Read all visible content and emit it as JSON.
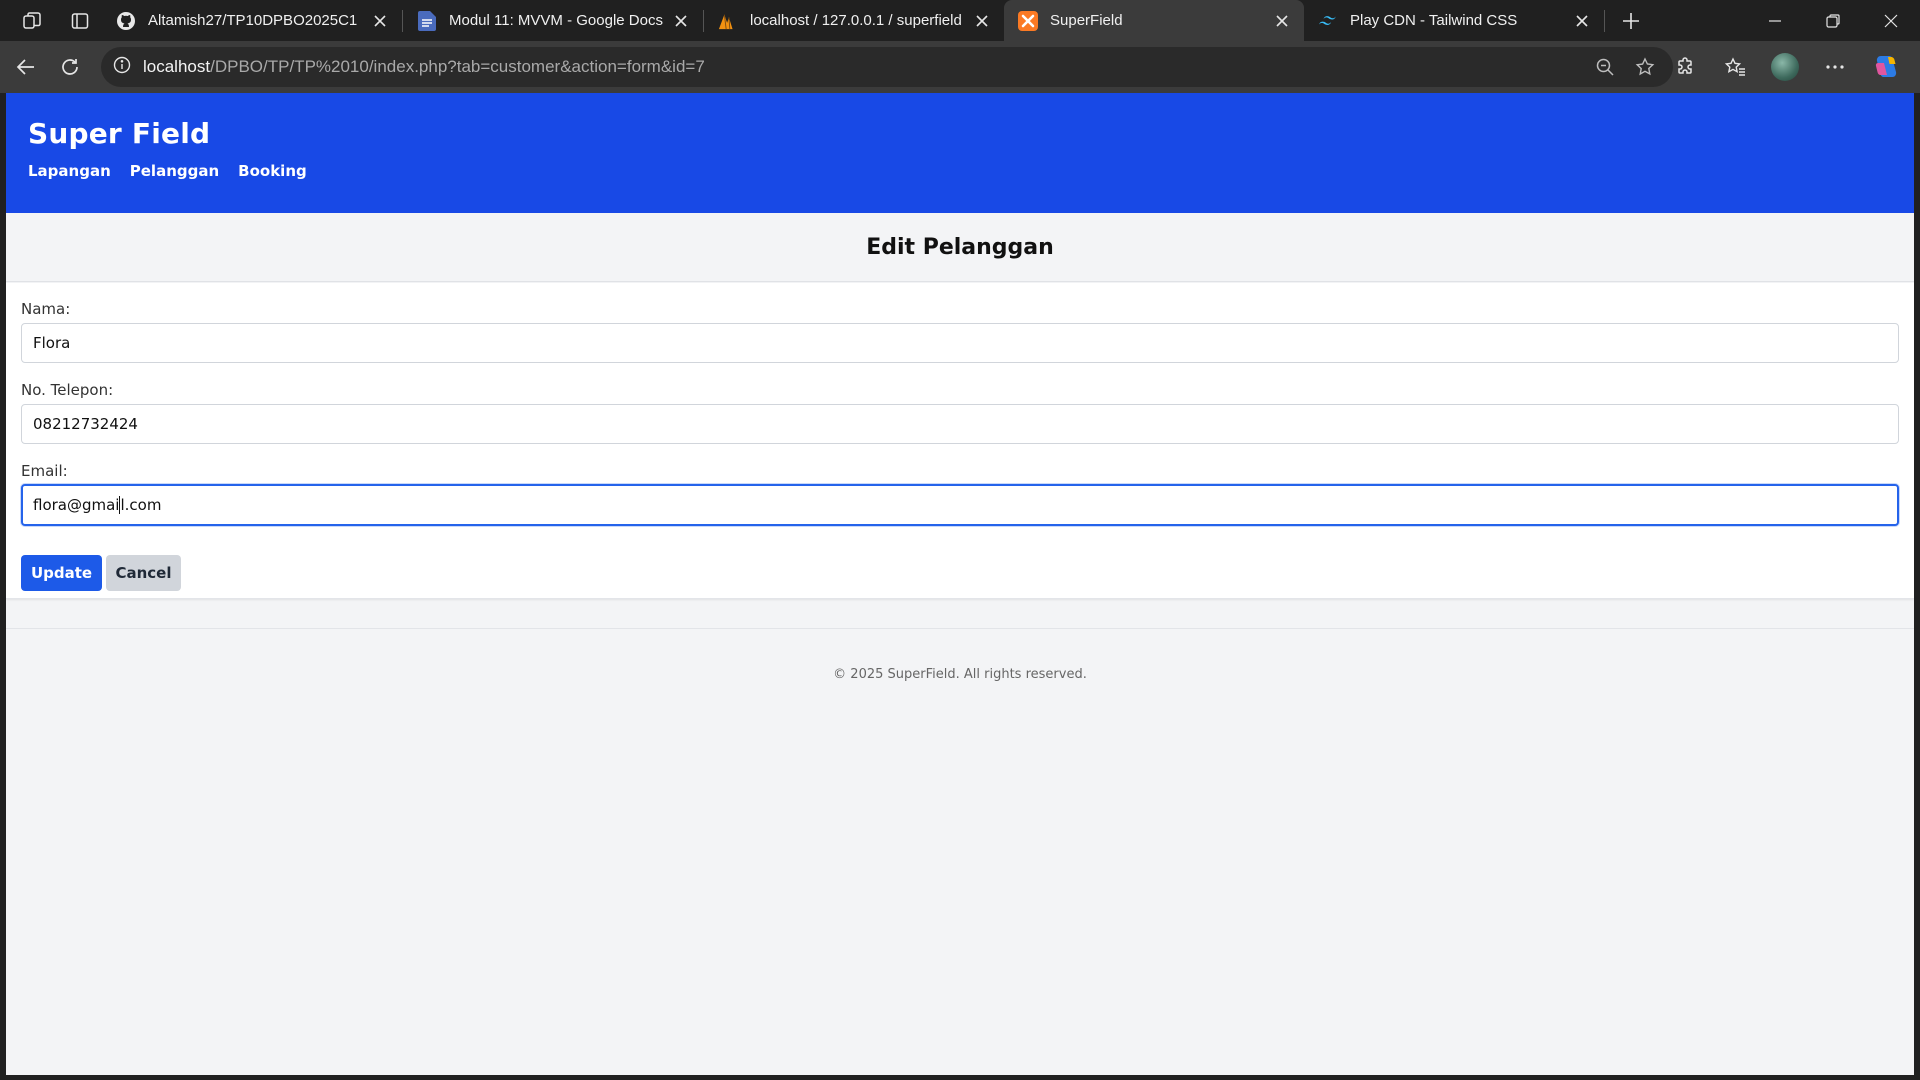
{
  "browser": {
    "tabs": [
      {
        "title": "Altamish27/TP10DPBO2025C1",
        "favicon": "github-icon",
        "active": false
      },
      {
        "title": "Modul 11: MVVM - Google Docs",
        "favicon": "google-docs-icon",
        "active": false
      },
      {
        "title": "localhost / 127.0.0.1 / superfield /",
        "favicon": "phpmyadmin-icon",
        "active": false
      },
      {
        "title": "SuperField",
        "favicon": "xampp-icon",
        "active": true
      },
      {
        "title": "Play CDN - Tailwind CSS",
        "favicon": "tailwind-icon",
        "active": false
      }
    ],
    "url_host": "localhost",
    "url_path": "/DPBO/TP/TP%2010/index.php?tab=customer&action=form&id=7"
  },
  "site": {
    "brand": "Super Field",
    "brand_color": "#1849e6",
    "nav": [
      {
        "label": "Lapangan"
      },
      {
        "label": "Pelanggan"
      },
      {
        "label": "Booking"
      }
    ]
  },
  "form": {
    "heading": "Edit Pelanggan",
    "fields": [
      {
        "label": "Nama:",
        "value": "Flora"
      },
      {
        "label": "No. Telepon:",
        "value": "08212732424"
      },
      {
        "label": "Email:",
        "value_before_caret": "flora@gmai",
        "value_after_caret": "l.com"
      }
    ],
    "update_label": "Update",
    "cancel_label": "Cancel"
  },
  "footer": {
    "text": "© 2025 SuperField. All rights reserved."
  }
}
